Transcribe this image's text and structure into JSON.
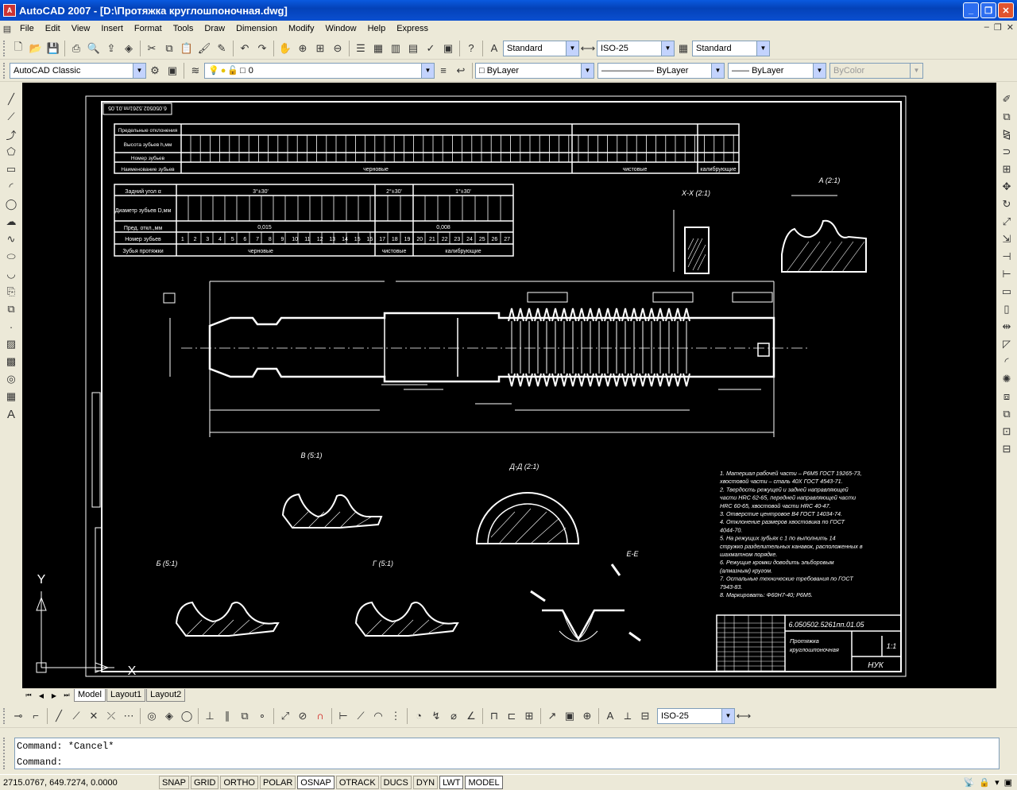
{
  "window": {
    "title": "AutoCAD 2007 - [D:\\Протяжка круглошпоночная.dwg]",
    "app_icon": "autocad-logo-icon"
  },
  "menu": [
    "File",
    "Edit",
    "View",
    "Insert",
    "Format",
    "Tools",
    "Draw",
    "Dimension",
    "Modify",
    "Window",
    "Help",
    "Express"
  ],
  "styles": {
    "text_style": "Standard",
    "dim_style": "ISO-25",
    "table_style": "Standard"
  },
  "workspace": "AutoCAD Classic",
  "layer": "0",
  "properties": {
    "color": "ByLayer",
    "linetype": "ByLayer",
    "lineweight": "ByLayer",
    "plotstyle": "ByColor"
  },
  "dim_toolbar_style": "ISO-25",
  "drawing": {
    "title_block_number": "6.050502.5261пп.01.05",
    "title_block_name_1": "Протяжка",
    "title_block_name_2": "круглошпоночная",
    "scale": "1:1",
    "org": "НУК",
    "stamp_top": "6.050502.5261пп.01.05",
    "view_a": "A (2:1)",
    "view_xx": "X-X (2:1)",
    "view_v": "В (5:1)",
    "view_dd": "Д-Д (2:1)",
    "view_b": "Б (5:1)",
    "view_g": "Г (5:1)",
    "view_ee": "Е-Е",
    "table1": {
      "rows": [
        "Предельные отклонения",
        "Высота зубьев h,мм",
        "Номер зубьев",
        "Наименование зубьев"
      ],
      "groups": [
        "черновые",
        "чистовые",
        "калибрующие"
      ]
    },
    "table2": {
      "rows": [
        "Задний угол α",
        "Диаметр зубьев D,мм",
        "Пред. откл.,мм",
        "Номер зубьев",
        "Зубья протяжки"
      ],
      "angles": [
        "3°±30'",
        "2°±30'",
        "1°±30'"
      ],
      "tolerances": [
        "0,015",
        "0,008"
      ],
      "names": [
        "черновые",
        "чистовые",
        "калибрующие"
      ],
      "numbers": [
        "1",
        "2",
        "3",
        "4",
        "5",
        "6",
        "7",
        "8",
        "9",
        "10",
        "11",
        "12",
        "13",
        "14",
        "15",
        "16",
        "17",
        "18",
        "19",
        "20",
        "21",
        "22",
        "23",
        "24",
        "25",
        "26",
        "27"
      ]
    },
    "notes": [
      "1. Материал рабочей части – Р6М5 ГОСТ 19265-73,",
      "хвостовой части – сталь 40Х ГОСТ 4543-71.",
      "2. Твердость режущей и задней направляющей",
      "части HRC 62-65, передней направляющей части",
      "HRC 60-65, хвостовой части HRC 40-47.",
      "3. Отверстие центровое В4 ГОСТ 14034-74.",
      "4. Отклонение размеров хвостовика по ГОСТ",
      "4044-70.",
      "5. На режущих зубьях с 1 по  выполнить 14",
      "стружко разделительных канавок, расположенных в",
      "шахматном порядке.",
      "6. Режущие кромки доводить эльборовым",
      "(алмазным) кругом.",
      "7. Остальные технические требования по ГОСТ",
      "7943-83.",
      "8. Маркировать: Ф60Н7-40; Р6М5."
    ]
  },
  "layout_tabs": [
    "Model",
    "Layout1",
    "Layout2"
  ],
  "command": {
    "history": "Command: *Cancel*",
    "prompt": "Command:"
  },
  "status": {
    "coords": "2715.0767, 649.7274, 0.0000",
    "toggles": [
      {
        "label": "SNAP",
        "on": false
      },
      {
        "label": "GRID",
        "on": false
      },
      {
        "label": "ORTHO",
        "on": false
      },
      {
        "label": "POLAR",
        "on": false
      },
      {
        "label": "OSNAP",
        "on": true
      },
      {
        "label": "OTRACK",
        "on": false
      },
      {
        "label": "DUCS",
        "on": false
      },
      {
        "label": "DYN",
        "on": false
      },
      {
        "label": "LWT",
        "on": true
      },
      {
        "label": "MODEL",
        "on": true
      }
    ]
  }
}
